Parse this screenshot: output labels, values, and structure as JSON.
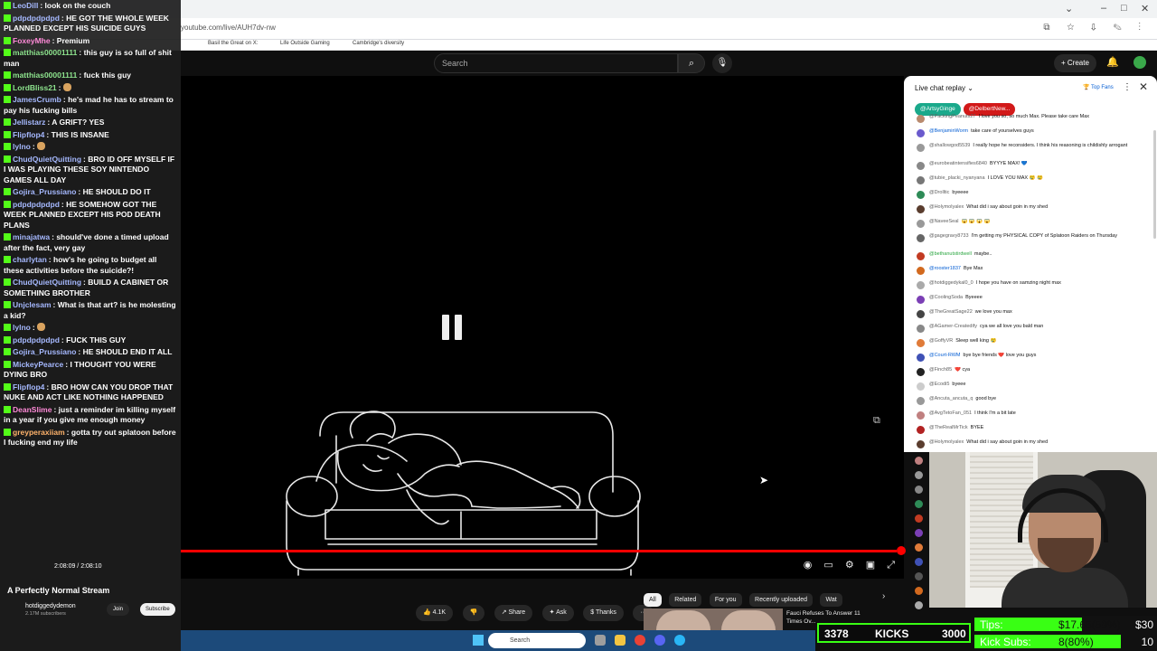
{
  "browser": {
    "url": "youtube.com/live/AUH7dv-nw",
    "bookmarks": [
      "Basil the Great on X:",
      "Life Outside Gaming",
      "Cambridge's diversity"
    ],
    "window_controls": [
      "⌄",
      "–",
      "□",
      "✕"
    ]
  },
  "youtube": {
    "search_placeholder": "Search",
    "create_label": "Create",
    "video": {
      "progress_fraction": 0.99,
      "time": "2:08:09 / 2:08:10",
      "channel_title": "A Perfectly Normal Stream",
      "channel_name": "hotdiggedydemon",
      "channel_subs": "2.17M subscribers",
      "join_label": "Join",
      "subscribe_label": "Subscribe"
    },
    "actions": {
      "likes": "4.1K",
      "share": "Share",
      "ask": "Ask",
      "thanks": "Thanks",
      "more": "···"
    },
    "chips": [
      "All",
      "Related",
      "For you",
      "Recently uploaded",
      "Wat"
    ],
    "recommendation": {
      "title": "Fauci Refuses To Answer 11 Times Ov..."
    }
  },
  "livechat": {
    "header": "Live chat replay",
    "top_fans": "Top Fans",
    "pinned": [
      {
        "name": "@ArtsyGinge",
        "color": "#1aa98b"
      },
      {
        "name": "@DelbertNew...",
        "color": "#d21919"
      }
    ],
    "messages": [
      {
        "author": "@PackingPeanuts27",
        "text": "I love you so, so much Max. Please take care Max",
        "av": "#b98a6e",
        "kind": "normal"
      },
      {
        "author": "@BenjaminWorm",
        "text": "take care of yourselves guys",
        "av": "#6a5acd",
        "kind": "member"
      },
      {
        "author": "@shallowgod5539",
        "text": "I really hope he reconsiders. I think his reasoning is childishly arrogant",
        "av": "#999999",
        "kind": "normal"
      },
      {
        "author": "@eurobeatintensifies6840",
        "text": "BYYYE MAX! 💙",
        "av": "#888888",
        "kind": "normal"
      },
      {
        "author": "@tubie_placki_nyanyana",
        "text": "I LOVE YOU MAX 😢 😢",
        "av": "#777777",
        "kind": "normal"
      },
      {
        "author": "@Drolltic",
        "text": "byeeee",
        "av": "#2e8b57",
        "kind": "normal"
      },
      {
        "author": "@Holymolyalex",
        "text": "What did i say about goin in my shed",
        "av": "#5a3d2e",
        "kind": "normal"
      },
      {
        "author": "@NaveeSeal",
        "text": "😱 😱 😱 😱",
        "av": "#999999",
        "kind": "normal"
      },
      {
        "author": "@gagegravy8733",
        "text": "I'm getting my PHYSICAL COPY of Splatoon Raiders on Thursday",
        "av": "#666666",
        "kind": "normal"
      },
      {
        "author": "@bethanutstirdwell",
        "text": "maybe..",
        "av": "#c23b22",
        "kind": "mod"
      },
      {
        "author": "@rooster1837",
        "text": "Bye Max",
        "av": "#d2691e",
        "kind": "member"
      },
      {
        "author": "@hotdiggedykal0_0",
        "text": "I hope you have on samzing night max",
        "av": "#aaaaaa",
        "kind": "normal"
      },
      {
        "author": "@CoolingSoda",
        "text": "Byeeee",
        "av": "#7b3fb5",
        "kind": "normal"
      },
      {
        "author": "@TheGreatSage22",
        "text": "we love you max",
        "av": "#444444",
        "kind": "normal"
      },
      {
        "author": "@AGamer-Createdify",
        "text": "cya we all love you bald man",
        "av": "#888888",
        "kind": "normal"
      },
      {
        "author": "@GoffyVR",
        "text": "Sleep well king 😢",
        "av": "#e07b39",
        "kind": "normal"
      },
      {
        "author": "@Court-RWM",
        "text": "bye bye friends ❤️ love you guys",
        "av": "#3f51b5",
        "kind": "member"
      },
      {
        "author": "@Finch85",
        "text": "❤️ cya",
        "av": "#222222",
        "kind": "normal"
      },
      {
        "author": "@Ecodi5",
        "text": "byeee",
        "av": "#cccccc",
        "kind": "normal"
      },
      {
        "author": "@Ancuta_ancuta_q",
        "text": "good bye",
        "av": "#999999",
        "kind": "normal"
      },
      {
        "author": "@AvgTetoFan_051",
        "text": "I think I'm a bit late",
        "av": "#c08080",
        "kind": "normal"
      },
      {
        "author": "@TheRealMrTick",
        "text": "BYEE",
        "av": "#b22222",
        "kind": "normal"
      },
      {
        "author": "@Holymolyalex",
        "text": "What did i say about goin in my shed",
        "av": "#5a3d2e",
        "kind": "normal"
      }
    ]
  },
  "kick_chat": [
    {
      "user": "LeoDill",
      "text": "look on the couch",
      "c": ""
    },
    {
      "user": "pdpdpdpdpd",
      "text": "HE GOT THE WHOLE WEEK PLANNED EXCEPT HIS SUICIDE GUYS",
      "c": ""
    },
    {
      "user": "FoxeyMhe",
      "text": "Premium",
      "c": "p"
    },
    {
      "user": "matthias00001111",
      "text": "this guy is so full of shit man",
      "c": "g"
    },
    {
      "user": "matthias00001111",
      "text": "fuck this guy",
      "c": "g"
    },
    {
      "user": "LordBliss21",
      "text": "",
      "c": "g"
    },
    {
      "user": "JamesCrumb",
      "text": "he's mad he has to stream to pay his fucking bills",
      "c": ""
    },
    {
      "user": "Jellistarz",
      "text": "A GRIFT? YES",
      "c": ""
    },
    {
      "user": "Flipflop4",
      "text": "THIS IS INSANE",
      "c": ""
    },
    {
      "user": "lylno",
      "text": "",
      "c": ""
    },
    {
      "user": "ChudQuietQuitting",
      "text": "BRO ID OFF MYSELF IF I WAS PLAYING THESE SOY NINTENDO GAMES ALL DAY",
      "c": ""
    },
    {
      "user": "Gojira_Prussiano",
      "text": "HE SHOULD DO IT",
      "c": ""
    },
    {
      "user": "pdpdpdpdpd",
      "text": "HE SOMEHOW GOT THE WEEK PLANNED EXCEPT HIS POD DEATH PLANS",
      "c": ""
    },
    {
      "user": "minajatwa",
      "text": "should've done a timed upload after the fact, very gay",
      "c": ""
    },
    {
      "user": "charlytan",
      "text": "how's he going to budget all these activities before the suicide?!",
      "c": ""
    },
    {
      "user": "ChudQuietQuitting",
      "text": "BUILD A CABINET OR SOMETHING BROTHER",
      "c": ""
    },
    {
      "user": "Unjclesam",
      "text": "What is that art? is he molesting a kid?",
      "c": ""
    },
    {
      "user": "lylno",
      "text": "",
      "c": ""
    },
    {
      "user": "pdpdpdpdpd",
      "text": "FUCK THIS GUY",
      "c": ""
    },
    {
      "user": "Gojira_Prussiano",
      "text": "HE SHOULD END IT ALL",
      "c": ""
    },
    {
      "user": "MickeyPearce",
      "text": "I THOUGHT YOU WERE DYING BRO",
      "c": ""
    },
    {
      "user": "Flipflop4",
      "text": "BRO HOW CAN YOU DROP THAT NUKE AND ACT LIKE NOTHING HAPPENED",
      "c": ""
    },
    {
      "user": "DeanSlime",
      "text": "just a reminder im killing myself in a year if you give me enough money",
      "c": "p"
    },
    {
      "user": "greyperaxiiam",
      "text": "gotta try out splatoon before I fucking end my life",
      "c": "o"
    }
  ],
  "overlay": {
    "tips_label": "Tips:",
    "tips_value": "$17.65(59%)",
    "tips_goal": "$30",
    "tips_fraction": 0.59,
    "kick_subs_label": "Kick Subs:",
    "kick_subs_value": "8(80%)",
    "kick_subs_goal": "10",
    "kick_subs_fraction": 0.8,
    "kicks_left": "3378",
    "kicks_label": "KICKS",
    "kicks_right": "3000"
  },
  "taskbar": {
    "search_label": "Search"
  }
}
